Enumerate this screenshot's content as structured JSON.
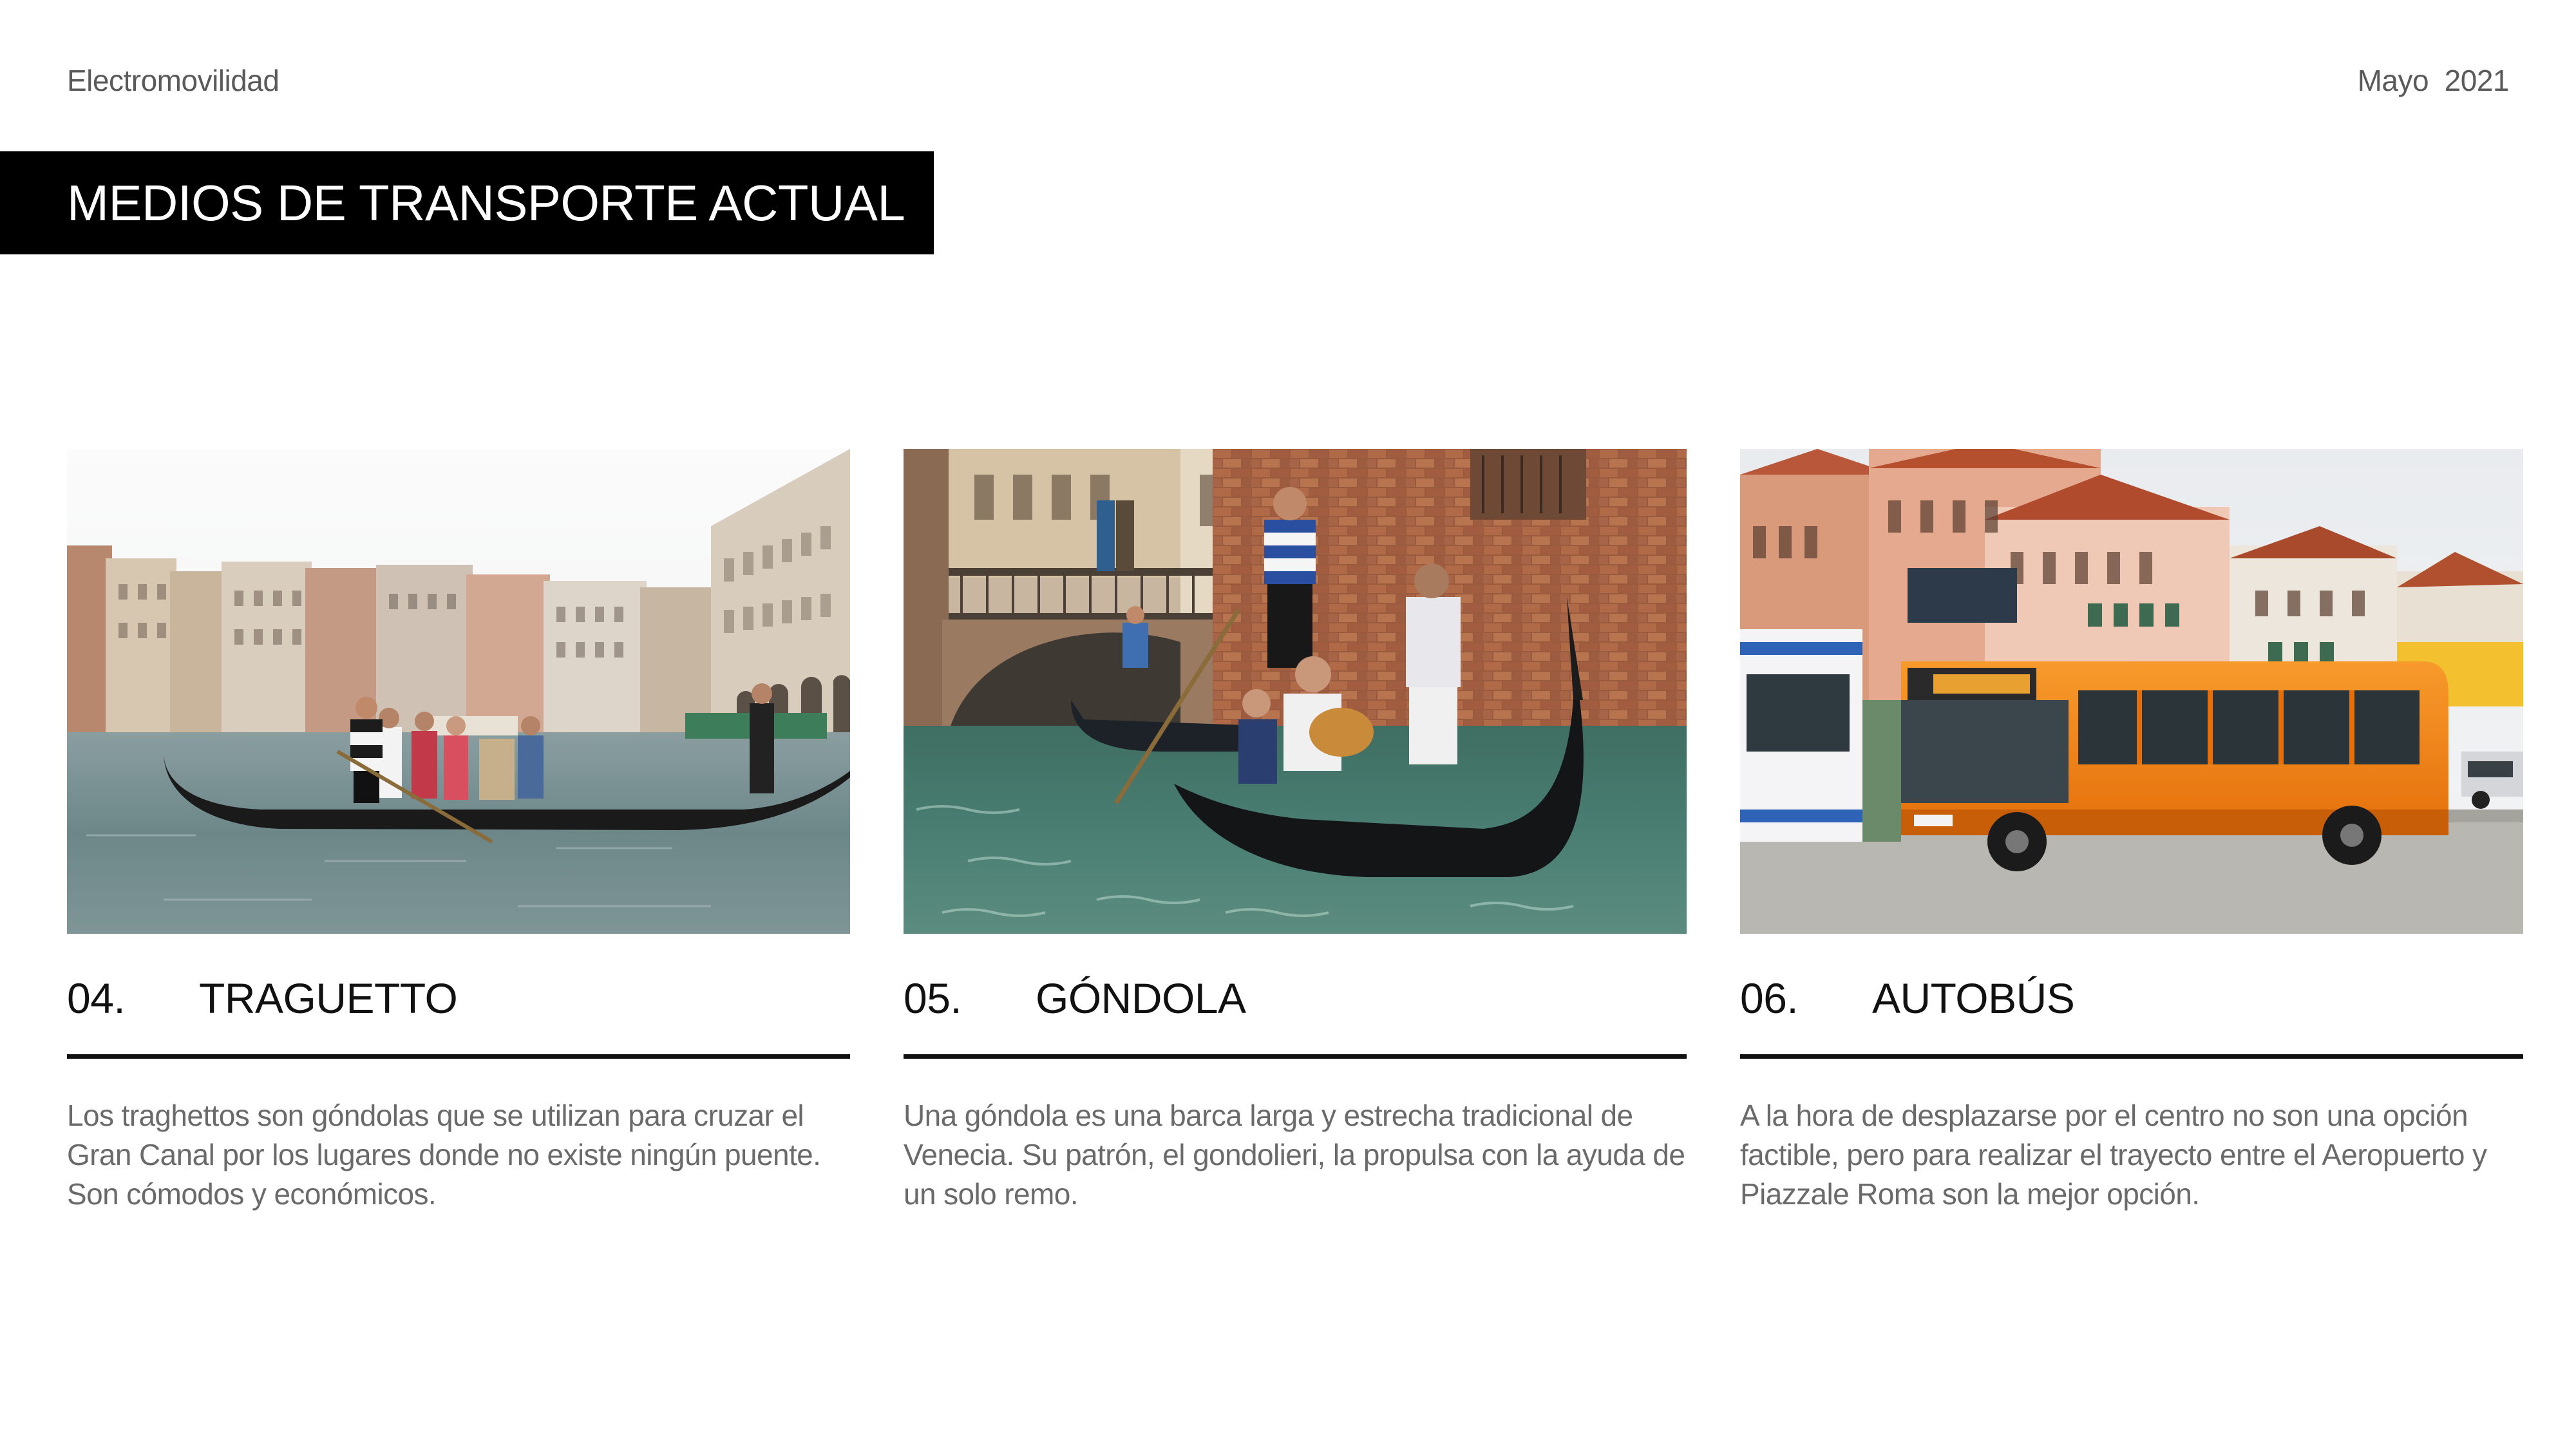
{
  "header": {
    "section": "Electromovilidad",
    "date": "Mayo  2021"
  },
  "title": "MEDIOS DE TRANSPORTE ACTUAL",
  "cards": [
    {
      "number": "04.",
      "heading": "TRAGUETTO",
      "description": "Los traghettos son góndolas que se utilizan para cruzar el Gran Canal por los lugares donde no existe ningún puente. Son cómodos y económicos."
    },
    {
      "number": "05.",
      "heading": "GÓNDOLA",
      "description": "Una góndola es una barca larga y estrecha tradicional de Venecia. Su patrón, el gondolieri, la propulsa con la ayuda de un solo remo."
    },
    {
      "number": "06.",
      "heading": "AUTOBÚS",
      "description": "A la hora de desplazarse por el centro no son una opción factible, pero para realizar el trayecto entre el Aeropuerto y Piazzale Roma son la mejor opción."
    }
  ],
  "colors": {
    "title_band": "#000000",
    "bus_orange": "#f07d12",
    "canal_water": "#5f8586"
  }
}
